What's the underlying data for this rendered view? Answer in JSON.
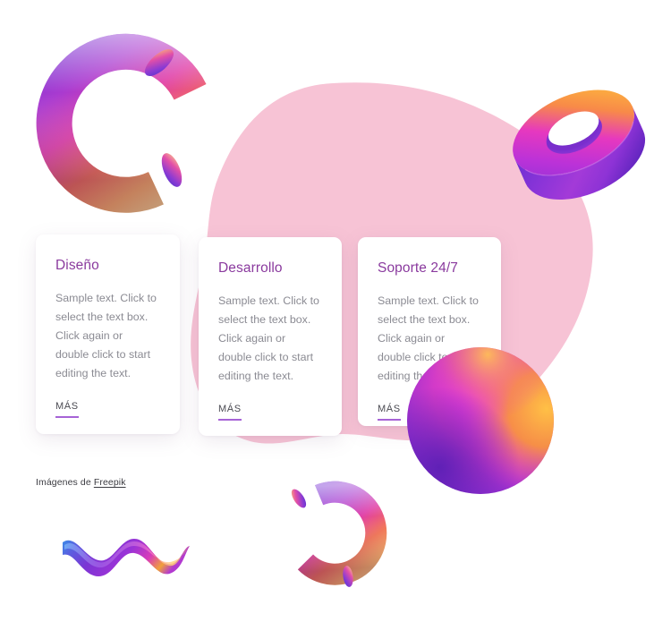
{
  "page": {
    "background_color": "#ffffff",
    "blob_color": "#f7c3d5",
    "accent_purple": "#a663d6",
    "title_color": "#8a3a9e",
    "body_text_color": "#8b8b93"
  },
  "cards": [
    {
      "title": "Diseño",
      "body": "Sample text. Click to select the text box. Click again or double click to start editing the text.",
      "more_label": "MÁS"
    },
    {
      "title": "Desarrollo",
      "body": "Sample text. Click to select the text box. Click again or double click to start editing the text.",
      "more_label": "MÁS"
    },
    {
      "title": "Soporte 24/7",
      "body": "Sample text. Click to select the text box. Click again or double click to start editing the text.",
      "more_label": "MÁS"
    }
  ],
  "credit": {
    "prefix": "Imágenes de ",
    "link_label": "Freepik"
  },
  "decorations": [
    {
      "name": "arc-tube-top-left",
      "shape": "3d-arc-tube",
      "colors": [
        "#6d3bd4",
        "#d73bb0",
        "#f06a4a",
        "#ffc46b"
      ]
    },
    {
      "name": "torus-top-right",
      "shape": "3d-torus",
      "colors": [
        "#7b2fd4",
        "#d63bc6",
        "#f8a13a",
        "#ffc93a"
      ]
    },
    {
      "name": "sphere-right",
      "shape": "3d-sphere",
      "colors": [
        "#7b2fd4",
        "#e635d6",
        "#f9a03a",
        "#ffc046"
      ]
    },
    {
      "name": "squiggle-bottom-left",
      "shape": "3d-squiggle",
      "colors": [
        "#3b8fe8",
        "#7b35d4",
        "#d93bb8",
        "#f0a03a"
      ]
    },
    {
      "name": "arc-tube-bottom",
      "shape": "3d-arc-tube",
      "colors": [
        "#6d3bd4",
        "#d73bb0",
        "#f06a4a",
        "#ffc46b"
      ]
    },
    {
      "name": "pink-blob",
      "shape": "organic-blob",
      "colors": [
        "#f7c3d5"
      ]
    }
  ]
}
